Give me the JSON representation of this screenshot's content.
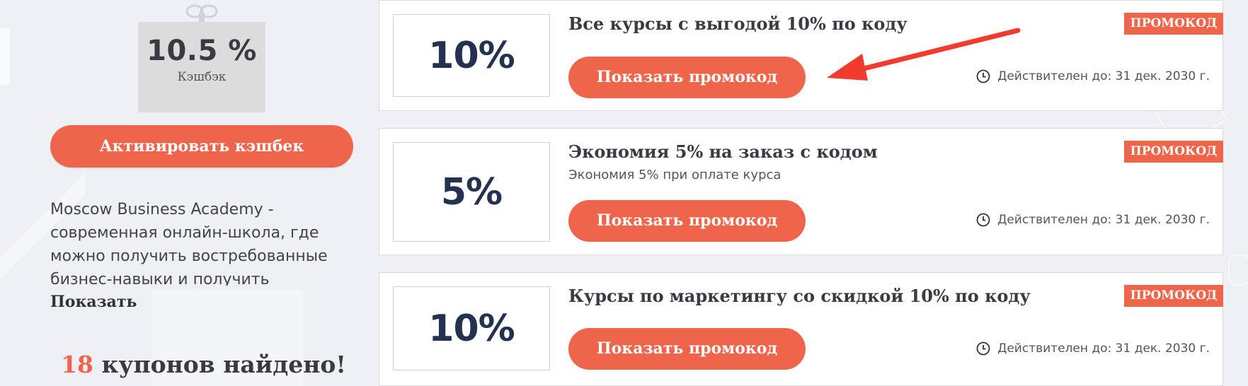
{
  "cashback": {
    "value": "10.5 %",
    "label": "Кэшбэк",
    "activate_label": "Активировать кэшбек"
  },
  "store": {
    "description": "Moscow Business Academy - современная онлайн-школа, где можно получить востребованные бизнес-навыки и получить",
    "show_more_label": "Показать"
  },
  "coupons_found": {
    "count": "18",
    "text": " купонов найдено!"
  },
  "coupons": [
    {
      "discount": "10%",
      "title": "Все курсы с выгодой 10% по коду",
      "subtitle": "",
      "button_label": "Показать промокод",
      "badge": "ПРОМОКОД",
      "validity": "Действителен до: 31 дек. 2030 г."
    },
    {
      "discount": "5%",
      "title": "Экономия 5% на заказ с кодом",
      "subtitle": "Экономия 5% при оплате курса",
      "button_label": "Показать промокод",
      "badge": "ПРОМОКОД",
      "validity": "Действителен до: 31 дек. 2030 г."
    },
    {
      "discount": "10%",
      "title": "Курсы по маркетингу со скидкой 10% по коду",
      "subtitle": "",
      "button_label": "Показать промокод",
      "badge": "ПРОМОКОД",
      "validity": "Действителен до: 31 дек. 2030 г."
    }
  ],
  "colors": {
    "accent": "#ef654b",
    "discount_text": "#243151",
    "arrow": "#f23a2f",
    "background": "#eef0f5"
  },
  "icons": {
    "gift_bow": "gift-bow-icon",
    "clock": "clock-icon",
    "arrow": "arrow-icon"
  }
}
